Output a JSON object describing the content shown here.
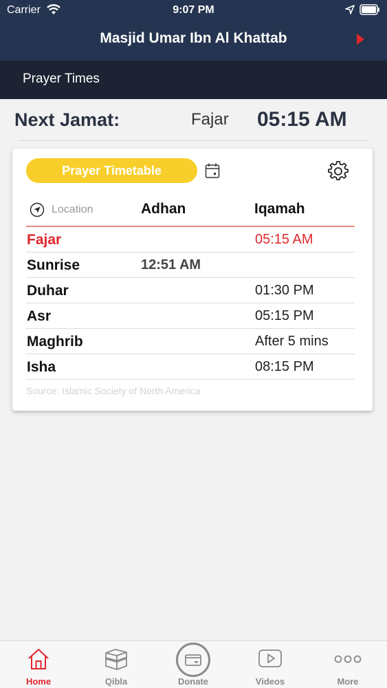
{
  "status": {
    "carrier": "Carrier",
    "time": "9:07 PM"
  },
  "nav": {
    "title": "Masjid Umar Ibn Al Khattab"
  },
  "subheader": {
    "title": "Prayer Times"
  },
  "next_jamat": {
    "label": "Next Jamat:",
    "prayer": "Fajar",
    "time": "05:15 AM"
  },
  "card": {
    "timetable_label": "Prayer Timetable",
    "location_label": "Location",
    "adhan_header": "Adhan",
    "iqamah_header": "Iqamah",
    "prayers": [
      {
        "name": "Fajar",
        "adhan": "",
        "iqamah": "05:15 AM"
      },
      {
        "name": "Sunrise",
        "adhan": "12:51 AM",
        "iqamah": ""
      },
      {
        "name": "Duhar",
        "adhan": "",
        "iqamah": "01:30 PM"
      },
      {
        "name": "Asr",
        "adhan": "",
        "iqamah": "05:15 PM"
      },
      {
        "name": "Maghrib",
        "adhan": "",
        "iqamah": "After 5 mins"
      },
      {
        "name": "Isha",
        "adhan": "",
        "iqamah": "08:15 PM"
      }
    ],
    "source": "Source: Islamic Society of North America"
  },
  "tabs": [
    {
      "label": "Home",
      "icon": "home-icon"
    },
    {
      "label": "Qibla",
      "icon": "kaaba-icon"
    },
    {
      "label": "Donate",
      "icon": "card-icon"
    },
    {
      "label": "Videos",
      "icon": "play-icon"
    },
    {
      "label": "More",
      "icon": "more-icon"
    }
  ],
  "colors": {
    "header": "#253450",
    "subheader": "#1d2333",
    "accent": "#e0272c",
    "button": "#f8cf2a"
  }
}
